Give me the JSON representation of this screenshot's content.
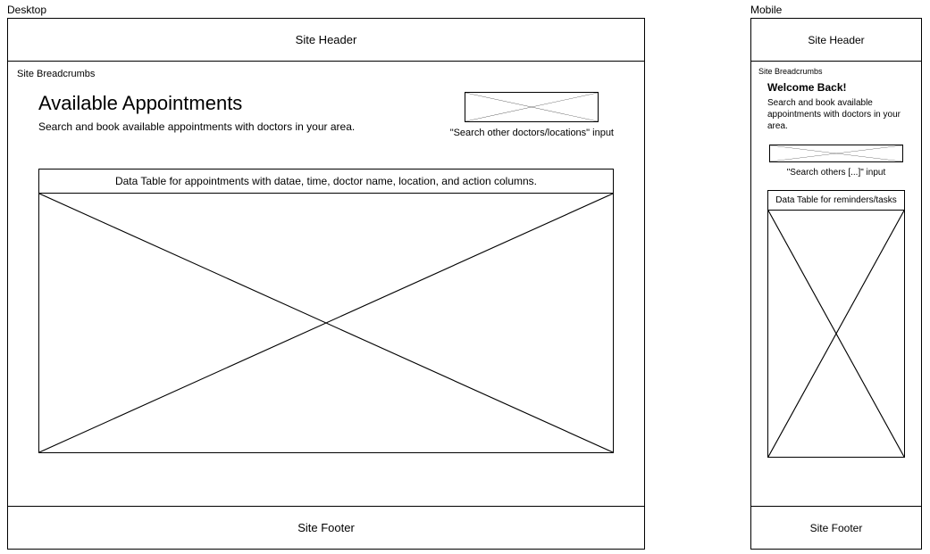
{
  "labels": {
    "desktop": "Desktop",
    "mobile": "Mobile"
  },
  "desktop": {
    "header": "Site Header",
    "footer": "Site Footer",
    "breadcrumb": "Site Breadcrumbs",
    "title": "Available Appointments",
    "subtitle": "Search and book available appointments with doctors in your area.",
    "search_caption": "\"Search other doctors/locations\" input",
    "table_header": "Data Table for appointments with datae, time, doctor name, location, and action columns."
  },
  "mobile": {
    "header": "Site Header",
    "footer": "Site Footer",
    "breadcrumb": "Site Breadcrumbs",
    "title": "Welcome Back!",
    "subtitle": "Search and book available appointments with doctors in your area.",
    "search_caption": "\"Search others [...]\" input",
    "table_header": "Data Table for reminders/tasks"
  }
}
